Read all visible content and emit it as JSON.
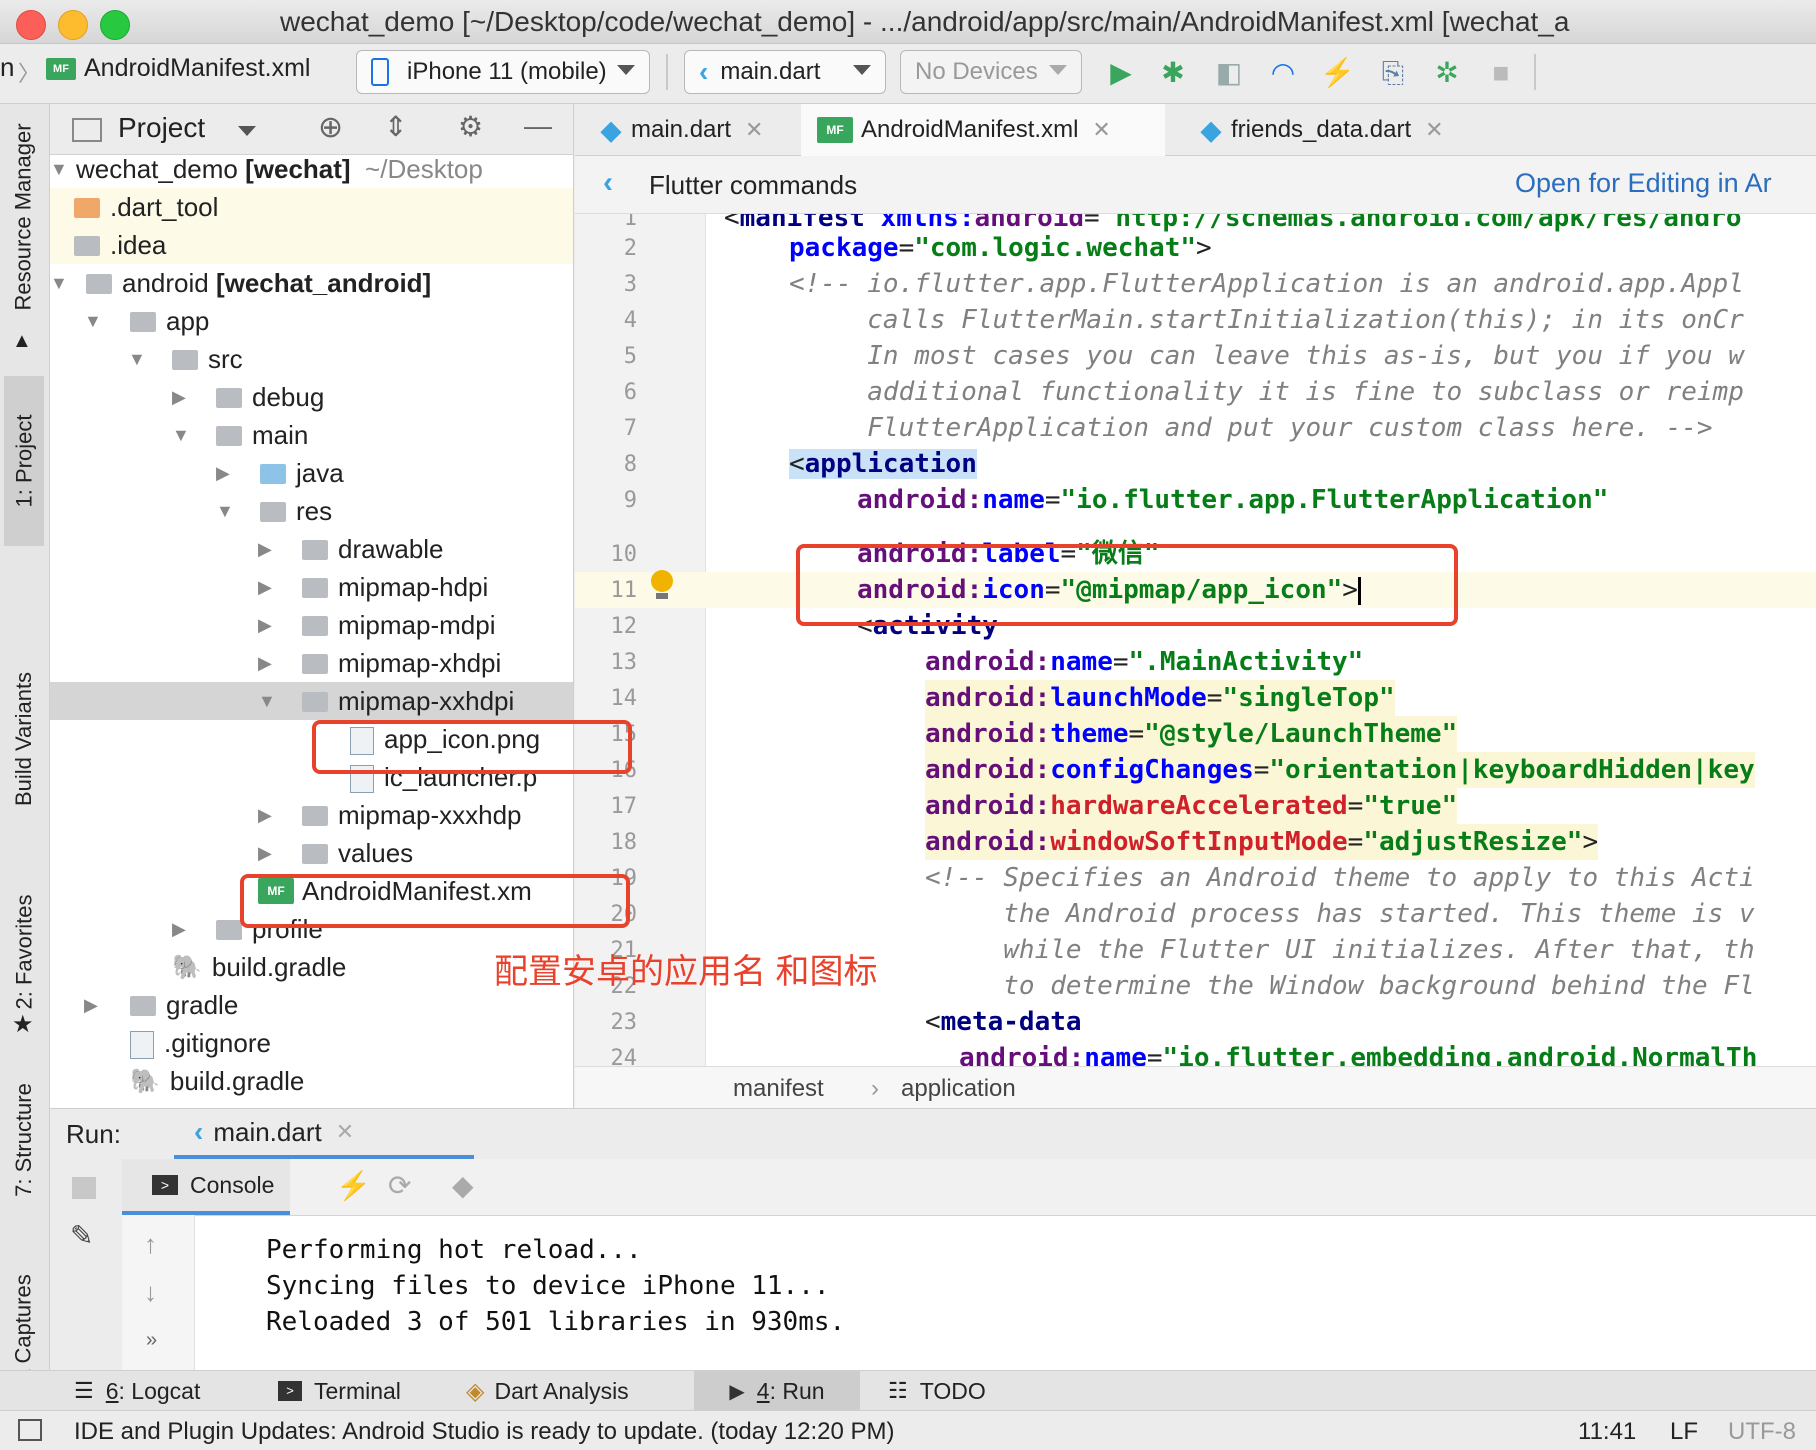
{
  "window": {
    "title": "wechat_demo [~/Desktop/code/wechat_demo] - .../android/app/src/main/AndroidManifest.xml [wechat_a"
  },
  "toolbar": {
    "breadcrumb_prefix": "n",
    "file_badge": "MF",
    "file": "AndroidManifest.xml",
    "device_selector": "iPhone 11 (mobile)",
    "run_config": "main.dart",
    "no_devices": "No Devices"
  },
  "left_strip": {
    "tabs": [
      "Resource Manager",
      "1: Project",
      "Build Variants",
      "2: Favorites",
      "7: Structure",
      "Layout Captures"
    ]
  },
  "project_panel": {
    "title": "Project",
    "tree": [
      {
        "label": "wechat_demo",
        "bold_suffix": "[wechat]",
        "dim_suffix": "~/Desktop",
        "icon": "folder"
      },
      {
        "label": ".dart_tool",
        "icon": "folder-orange"
      },
      {
        "label": ".idea",
        "icon": "folder"
      },
      {
        "label": "android",
        "bold_suffix": "[wechat_android]",
        "icon": "folder"
      },
      {
        "label": "app",
        "icon": "folder"
      },
      {
        "label": "src",
        "icon": "folder"
      },
      {
        "label": "debug",
        "icon": "folder"
      },
      {
        "label": "main",
        "icon": "folder"
      },
      {
        "label": "java",
        "icon": "folder-blue"
      },
      {
        "label": "res",
        "icon": "folder"
      },
      {
        "label": "drawable",
        "icon": "folder"
      },
      {
        "label": "mipmap-hdpi",
        "icon": "folder"
      },
      {
        "label": "mipmap-mdpi",
        "icon": "folder"
      },
      {
        "label": "mipmap-xhdpi",
        "icon": "folder"
      },
      {
        "label": "mipmap-xxhdpi",
        "icon": "folder"
      },
      {
        "label": "app_icon.png",
        "icon": "image-file"
      },
      {
        "label": "ic_launcher.p",
        "icon": "image-file"
      },
      {
        "label": "mipmap-xxxhdp",
        "icon": "folder"
      },
      {
        "label": "values",
        "icon": "folder"
      },
      {
        "label": "AndroidManifest.xm",
        "icon": "manifest-file"
      },
      {
        "label": "profile",
        "icon": "folder"
      },
      {
        "label": "build.gradle",
        "icon": "gradle-file"
      },
      {
        "label": "gradle",
        "icon": "folder"
      },
      {
        "label": ".gitignore",
        "icon": "ignore-file"
      },
      {
        "label": "build.gradle",
        "icon": "gradle-file"
      }
    ]
  },
  "editor": {
    "tabs": [
      {
        "label": "main.dart",
        "active": false
      },
      {
        "label": "AndroidManifest.xml",
        "active": true
      },
      {
        "label": "friends_data.dart",
        "active": false
      }
    ],
    "flutter_bar": {
      "title": "Flutter commands",
      "link": "Open for Editing in Ar"
    },
    "line_numbers": [
      "1",
      "2",
      "3",
      "4",
      "5",
      "6",
      "7",
      "8",
      "9",
      "10",
      "11",
      "12",
      "13",
      "14",
      "15",
      "16",
      "17",
      "18",
      "19",
      "20",
      "21",
      "22",
      "23",
      "24"
    ],
    "code": {
      "l1": {
        "p1": "<",
        "tag": "manifest",
        "p2": " ",
        "ns": "xmlns:",
        "attr": "android",
        "eq": "=",
        "val": "\"http://schemas.android.com/apk/res/andro"
      },
      "l2": {
        "ns": "package",
        "eq": "=",
        "val": "\"com.logic.wechat\"",
        "close": ">"
      },
      "l3": "<!-- io.flutter.app.FlutterApplication is an android.app.Appl",
      "l4": "     calls FlutterMain.startInitialization(this); in its onCr",
      "l5": "     In most cases you can leave this as-is, but you if you w",
      "l6": "     additional functionality it is fine to subclass or reimp",
      "l7": "     FlutterApplication and put your custom class here. -->",
      "l8": {
        "p1": "<",
        "tag": "application"
      },
      "l9": {
        "ns": "android:",
        "attr": "name",
        "eq": "=",
        "val": "\"io.flutter.app.FlutterApplication\""
      },
      "l10": {
        "ns": "android:",
        "attr": "label",
        "eq": "=",
        "val": "\"微信\""
      },
      "l11": {
        "ns": "android:",
        "attr": "icon",
        "eq": "=",
        "val": "\"@mipmap/app_icon\"",
        "close": ">"
      },
      "l12": {
        "p1": "<",
        "tag": "activity"
      },
      "l13": {
        "ns": "android:",
        "attr": "name",
        "eq": "=",
        "val": "\".MainActivity\""
      },
      "l14": {
        "ns": "android:",
        "attr": "launchMode",
        "eq": "=",
        "val": "\"singleTop\""
      },
      "l15": {
        "ns": "android:",
        "attr": "theme",
        "eq": "=",
        "val": "\"@style/LaunchTheme\""
      },
      "l16": {
        "ns": "android:",
        "attr": "configChanges",
        "eq": "=",
        "val": "\"orientation|keyboardHidden|key"
      },
      "l17": {
        "ns": "android:",
        "attr": "hardwareAccelerated",
        "eq": "=",
        "val": "\"true\""
      },
      "l18": {
        "ns": "android:",
        "attr": "windowSoftInputMode",
        "eq": "=",
        "val": "\"adjustResize\"",
        "close": ">"
      },
      "l19": "<!-- Specifies an Android theme to apply to this Acti",
      "l20": "     the Android process has started. This theme is v",
      "l21": "     while the Flutter UI initializes. After that, th",
      "l22": "     to determine the Window background behind the Fl",
      "l23": {
        "p1": "<",
        "tag": "meta-data"
      },
      "l24": {
        "ns": "android:",
        "attr": "name",
        "eq": "=",
        "val": "\"io.flutter.embedding.android.NormalTh"
      }
    },
    "breadcrumb": [
      "manifest",
      "application"
    ]
  },
  "annotation": {
    "text": "配置安卓的应用名 和图标"
  },
  "run_panel": {
    "label": "Run:",
    "tab": "main.dart",
    "console_tab": "Console",
    "lines": [
      "Performing hot reload...",
      "Syncing files to device iPhone 11...",
      "Reloaded 3 of 501 libraries in 930ms."
    ]
  },
  "bottom_tabs": [
    {
      "prefix": "6",
      "label": ": Logcat"
    },
    {
      "prefix": "",
      "label": "Terminal"
    },
    {
      "prefix": "",
      "label": "Dart Analysis"
    },
    {
      "prefix": "4",
      "label": ": Run"
    },
    {
      "prefix": "",
      "label": "TODO"
    }
  ],
  "status_bar": {
    "message": "IDE and Plugin Updates: Android Studio is ready to update. (today 12:20 PM)",
    "position": "11:41",
    "line_sep": "LF",
    "encoding": "UTF-8"
  },
  "colors": {
    "annotation_red": "#e8412c",
    "xml_tag": "#000080",
    "xml_attr": "#660e7a",
    "xml_ns": "#0000ff",
    "xml_value": "#067d17",
    "comment": "#808080",
    "run_green": "#3aa55d"
  }
}
